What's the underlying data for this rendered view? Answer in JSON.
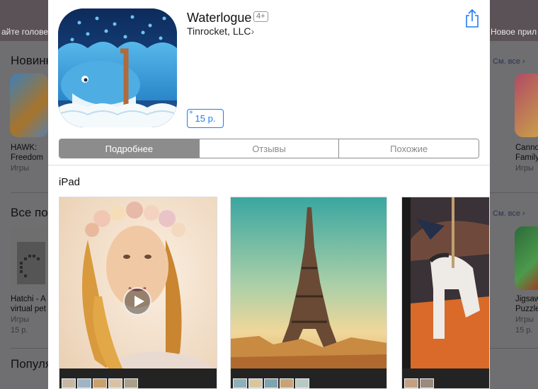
{
  "background": {
    "banner_left": "айте голове",
    "banner_right": "Новое прил",
    "sections": [
      {
        "title": "Новинки",
        "see_all": "См. все ›"
      },
      {
        "title": "Все по",
        "see_all": "См. все ›"
      },
      {
        "title": "Популя"
      }
    ],
    "apps_row1_left": {
      "name_line1": "HAWK:",
      "name_line2": "Freedom",
      "category": "Игры"
    },
    "apps_row1_right": {
      "name_line1": "Canno",
      "name_line2": "Family",
      "category": "Игры"
    },
    "apps_row2_left": {
      "name_line1": "Hatchi - A",
      "name_line2": "virtual pet",
      "category": "Игры",
      "price": "15 р."
    },
    "apps_row2_right": {
      "name_line1": "Jigsaw",
      "name_line2": "Puzzles",
      "category": "Игры",
      "price": "15 р."
    }
  },
  "app": {
    "title": "Waterlogue",
    "age_rating": "4+",
    "developer": "Tinrocket, LLC",
    "developer_chevron": "›",
    "price_plus": "+",
    "price": "15 р."
  },
  "tabs": [
    {
      "label": "Подробнее",
      "active": true
    },
    {
      "label": "Отзывы",
      "active": false
    },
    {
      "label": "Похожие",
      "active": false
    }
  ],
  "screenshots_section": {
    "device": "iPad"
  },
  "icons": [
    "share-icon",
    "play-icon",
    "chevron-right-icon",
    "camera-icon",
    "heart-icon"
  ],
  "colors": {
    "accent": "#1e7cf3",
    "segment_active": "#8c8c8c"
  }
}
